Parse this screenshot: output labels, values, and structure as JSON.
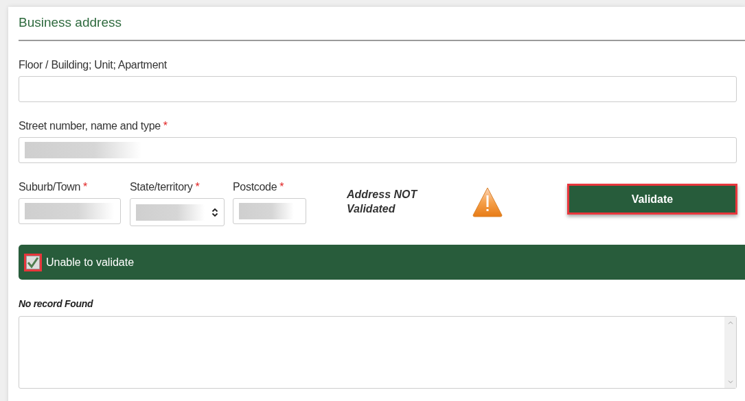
{
  "section": {
    "title": "Business address"
  },
  "fields": [
    {
      "label": "Floor / Building; Unit; Apartment"
    },
    {
      "label": "Street number, name and type",
      "required_mark": "*",
      "redacted": true
    }
  ],
  "location_fields": [
    {
      "kind": "text",
      "label": "Suburb/Town",
      "required_mark": "*",
      "redacted": true
    },
    {
      "kind": "select",
      "label": "State/territory",
      "required_mark": "*",
      "redacted": true
    },
    {
      "kind": "text",
      "label": "Postcode",
      "required_mark": "*",
      "redacted": true
    }
  ],
  "validation": {
    "status": "Address NOT Validated",
    "warning": true,
    "button": "Validate",
    "button_highlighted": true
  },
  "unable_to_validate": {
    "label": "Unable to validate",
    "checked": true,
    "highlighted": true
  },
  "notes": {
    "label": "No record Found"
  }
}
